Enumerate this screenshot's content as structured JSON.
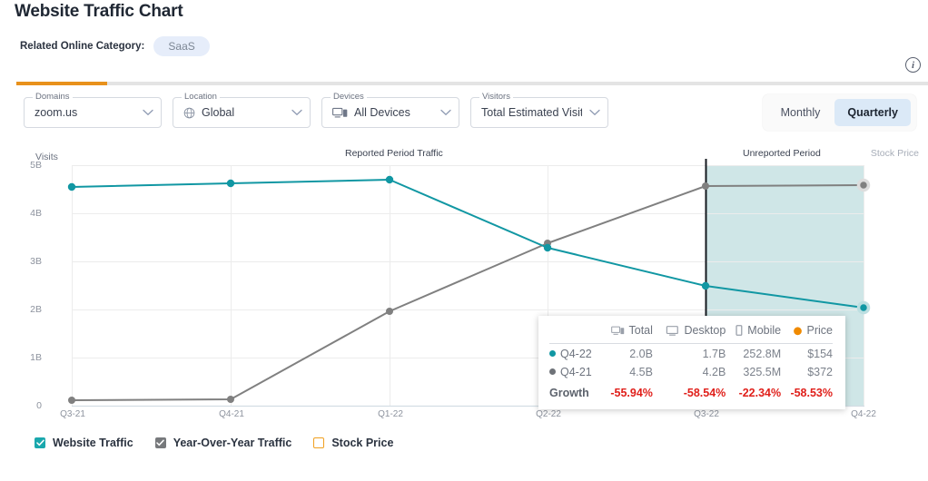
{
  "header": {
    "title": "Website Traffic Chart",
    "category_label": "Related Online Category:",
    "category_value": "SaaS",
    "info_icon": "info-icon",
    "info_glyph": "i"
  },
  "controls": {
    "domains": {
      "legend": "Domains",
      "value": "zoom.us"
    },
    "location": {
      "legend": "Location",
      "value": "Global",
      "icon": "globe-icon"
    },
    "devices": {
      "legend": "Devices",
      "value": "All Devices",
      "icon": "devices-icon"
    },
    "visitors": {
      "legend": "Visitors",
      "value": "Total Estimated Visits"
    },
    "granularity": {
      "options": [
        "Monthly",
        "Quarterly"
      ],
      "selected": "Quarterly"
    }
  },
  "chart_data": {
    "type": "line",
    "title": "",
    "categories": [
      "Q3-21",
      "Q4-21",
      "Q1-22",
      "Q2-22",
      "Q3-22",
      "Q4-22"
    ],
    "ylabel": "Visits",
    "y2label": "Stock Price",
    "yticks": [
      "5B",
      "4B",
      "3B",
      "2B",
      "1B",
      "0"
    ],
    "ylim": [
      0,
      5000000000
    ],
    "grid": true,
    "legend_position": "bottom",
    "annotations": {
      "reported": "Reported Period Traffic",
      "unreported": "Unreported Period",
      "unreported_start": "Q3-22"
    },
    "series": [
      {
        "name": "Website Traffic",
        "color": "#1197a3",
        "values": [
          4.55,
          4.6,
          4.7,
          3.32,
          2.48,
          2.0
        ]
      },
      {
        "name": "Year-Over-Year Traffic",
        "color": "#808080",
        "values": [
          0.12,
          0.13,
          1.96,
          3.4,
          4.55,
          4.58
        ]
      },
      {
        "name": "Stock Price",
        "color": "#f0a020",
        "values": [],
        "visible": false
      }
    ]
  },
  "tooltip": {
    "columns": [
      {
        "label": "Total",
        "icon": "devices-icon"
      },
      {
        "label": "Desktop",
        "icon": "desktop-icon"
      },
      {
        "label": "Mobile",
        "icon": "mobile-icon"
      },
      {
        "label": "Price",
        "icon": "price-dot-icon"
      }
    ],
    "rows": [
      {
        "label": "Q4-22",
        "dot": "#1197a3",
        "total": "2.0B",
        "desktop": "1.7B",
        "mobile": "252.8M",
        "price": "$154"
      },
      {
        "label": "Q4-21",
        "dot": "#6e7278",
        "total": "4.5B",
        "desktop": "4.2B",
        "mobile": "325.5M",
        "price": "$372"
      }
    ],
    "growth": {
      "label": "Growth",
      "total": "-55.94%",
      "desktop": "-58.54%",
      "mobile": "-22.34%",
      "price": "-58.53%"
    }
  },
  "legend": [
    {
      "label": "Website Traffic",
      "color": "#1aa8ad",
      "checked": true
    },
    {
      "label": "Year-Over-Year Traffic",
      "color": "#77797c",
      "checked": true
    },
    {
      "label": "Stock Price",
      "color": "#f0a020",
      "checked": false
    }
  ],
  "colors": {
    "accent_orange": "#e8911c",
    "teal": "#1197a3",
    "gray_series": "#808080",
    "unreported_fill": "#cfe6e7",
    "growth_negative": "#e0201b"
  }
}
